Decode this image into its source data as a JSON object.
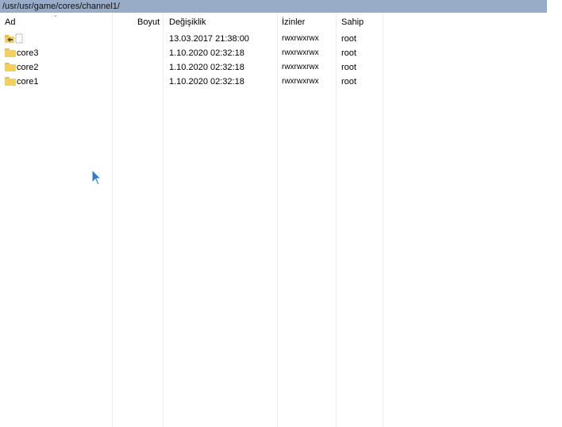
{
  "path": "/usr/usr/game/cores/channel1/",
  "columns": {
    "name": "Ad",
    "size": "Boyut",
    "modified": "Değişiklik",
    "permissions": "İzinler",
    "owner": "Sahip"
  },
  "rows": [
    {
      "name": "",
      "size": "",
      "modified": "13.03.2017 21:38:00",
      "permissions": "rwxrwxrwx",
      "owner": "root",
      "icon": "parent-folder-icon"
    },
    {
      "name": "core3",
      "size": "",
      "modified": "1.10.2020 02:32:18",
      "permissions": "rwxrwxrwx",
      "owner": "root",
      "icon": "folder-icon"
    },
    {
      "name": "core2",
      "size": "",
      "modified": "1.10.2020 02:32:18",
      "permissions": "rwxrwxrwx",
      "owner": "root",
      "icon": "folder-icon"
    },
    {
      "name": "core1",
      "size": "",
      "modified": "1.10.2020 02:32:18",
      "permissions": "rwxrwxrwx",
      "owner": "root",
      "icon": "folder-icon"
    }
  ],
  "colors": {
    "pathbar": "#98acc7",
    "folder": "#f3cf5c",
    "cursor": "#2a7fd4"
  }
}
